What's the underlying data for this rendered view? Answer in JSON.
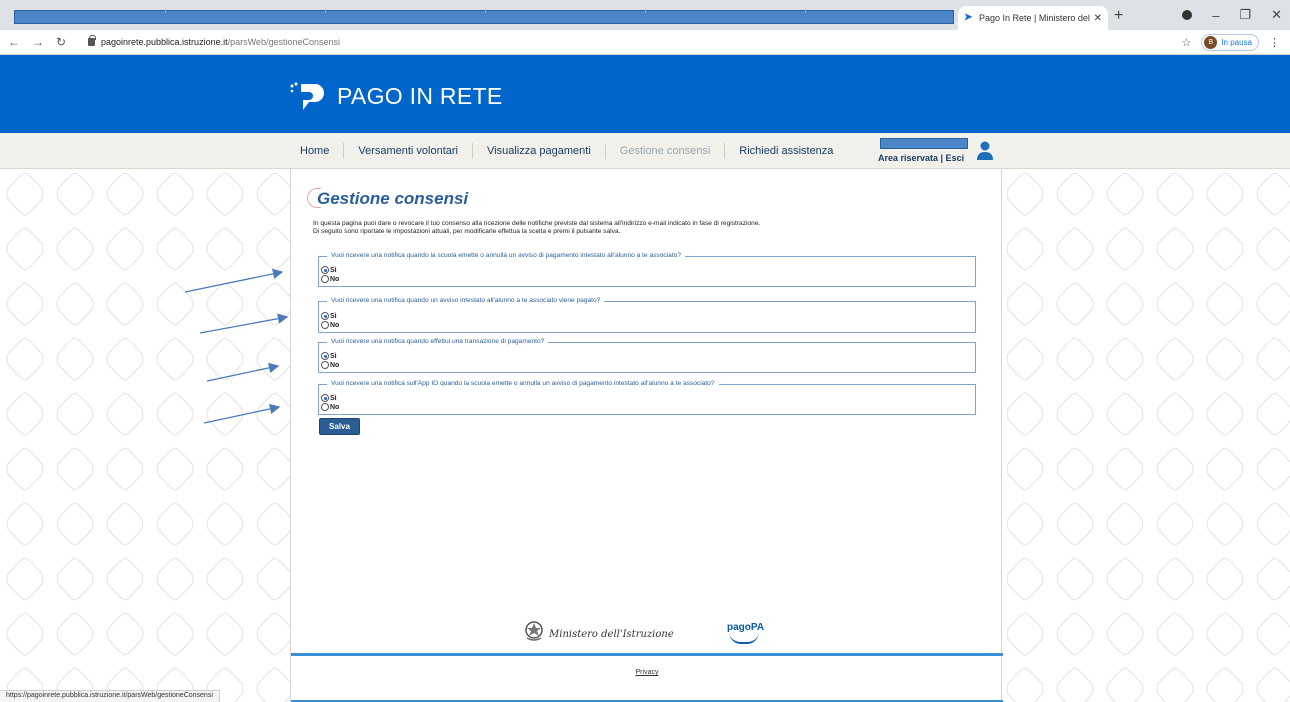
{
  "browser": {
    "tab_title": "Pago In Rete | Ministero dell'Istr",
    "url_host": "pagoinrete.pubblica.istruzione.it",
    "url_path": "/parsWeb/gestioneConsensi",
    "profile_label": "In pausa",
    "profile_initial": "B",
    "status_url": "https://pagoinrete.pubblica.istruzione.it/parsWeb/gestioneConsensi"
  },
  "site": {
    "logo_text": "PAGO IN RETE",
    "menu": [
      {
        "label": "Home"
      },
      {
        "label": "Versamenti volontari"
      },
      {
        "label": "Visualizza pagamenti"
      },
      {
        "label": "Gestione consensi"
      },
      {
        "label": "Richiedi assistenza"
      }
    ],
    "user_links": "Area riservata | Esci"
  },
  "page": {
    "title": "Gestione consensi",
    "intro_line1": "In questa pagina puoi dare o revocare il tuo consenso alla ricezione delle notifiche previste dal sistema all'indirizzo e-mail indicato in fase di registrazione.",
    "intro_line2": "Di seguito sono riportate le impostazioni attuali, per modificarle effettua la scelta e premi il pulsante salva.",
    "consents": [
      {
        "question": "Vuoi ricevere una notifica quando la scuola emette o annulla un avviso di pagamento intestato all'alunno a te associato?",
        "yes": "Sì",
        "no": "No",
        "selected": "yes"
      },
      {
        "question": "Vuoi ricevere una notifica quando un avviso intestato all'alunno a te associato viene pagato?",
        "yes": "Sì",
        "no": "No",
        "selected": "yes"
      },
      {
        "question": "Vuoi ricevere una notifica quando effettui una transazione di pagamento?",
        "yes": "Sì",
        "no": "No",
        "selected": "yes"
      },
      {
        "question": "Vuoi ricevere una notifica sull'App IO quando la scuola emette o annulla un avviso di pagamento intestato all'alunno a te associato?",
        "yes": "Sì",
        "no": "No",
        "selected": "yes"
      }
    ],
    "save_label": "Salva"
  },
  "footer": {
    "ministry": "Ministero dell'Istruzione",
    "pagopa": "pagoPA",
    "privacy": "Privacy"
  },
  "colors": {
    "header_blue": "#0066cc",
    "menu_bg": "#f1f0ea",
    "button_blue": "#2b5d94",
    "arrow": "#4a7ab8"
  }
}
